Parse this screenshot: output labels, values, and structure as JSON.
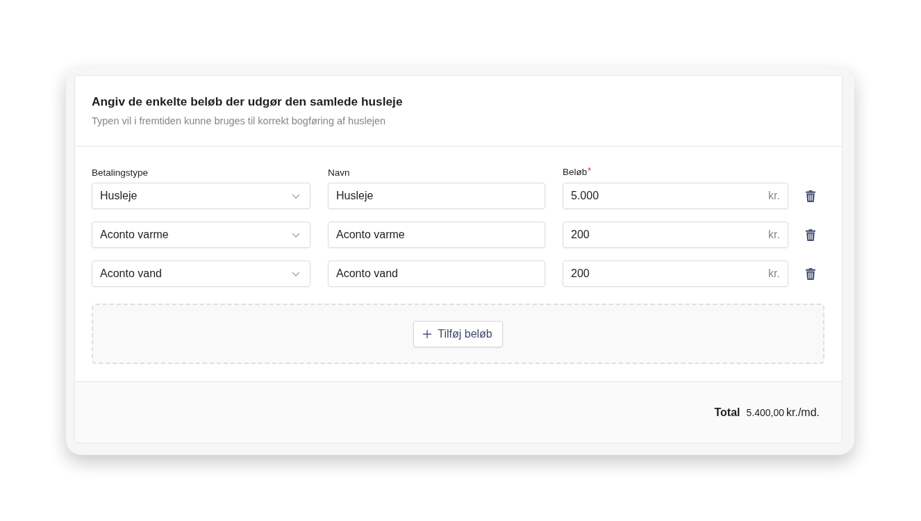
{
  "header": {
    "title": "Angiv de enkelte beløb der udgør den samlede husleje",
    "subtitle": "Typen vil i fremtiden kunne bruges til korrekt bogføring af huslejen"
  },
  "columns": [
    {
      "label": "Betalingstype"
    },
    {
      "label": "Navn"
    },
    {
      "label": "Beløb",
      "required_mark": "*"
    }
  ],
  "rows": [
    {
      "type": "Husleje",
      "name": "Husleje",
      "amount": "5.000",
      "currency": "kr."
    },
    {
      "type": "Aconto varme",
      "name": "Aconto varme",
      "amount": "200",
      "currency": "kr."
    },
    {
      "type": "Aconto vand",
      "name": "Aconto vand",
      "amount": "200",
      "currency": "kr."
    }
  ],
  "add_button": {
    "label": "Tilføj beløb"
  },
  "footer": {
    "total_label": "Total",
    "total_amount": "5.400,00",
    "total_unit": "kr./md."
  }
}
